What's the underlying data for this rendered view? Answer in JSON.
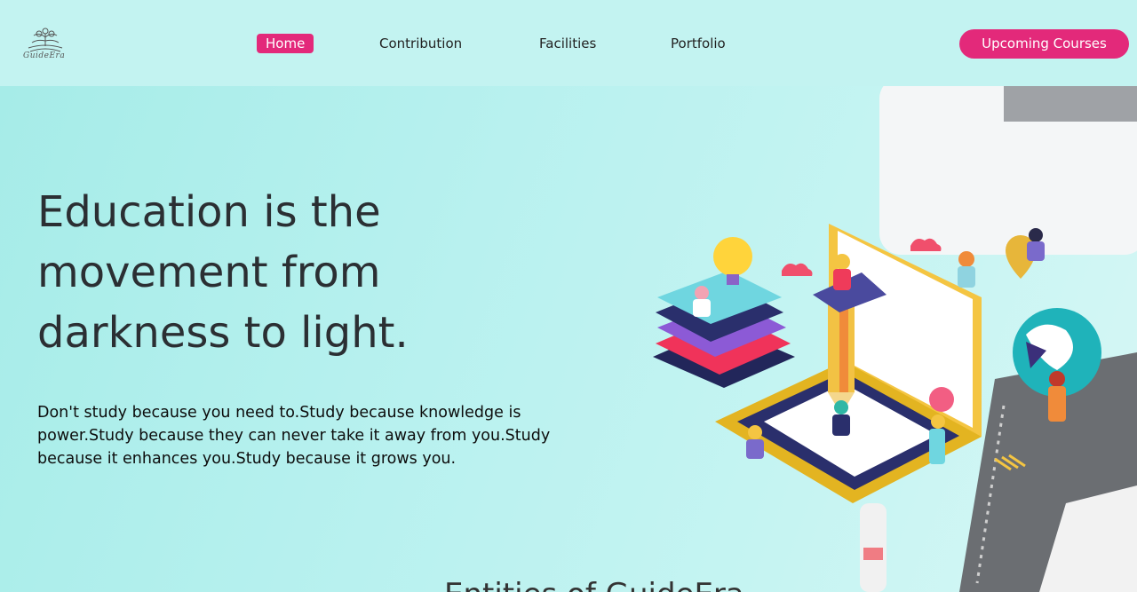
{
  "header": {
    "logo_text": "GuideEra",
    "nav": [
      {
        "label": "Home",
        "active": true
      },
      {
        "label": "Contribution",
        "active": false
      },
      {
        "label": "Facilities",
        "active": false
      },
      {
        "label": "Portfolio",
        "active": false
      }
    ],
    "cta_label": "Upcoming Courses"
  },
  "hero": {
    "headline_line1": "Education is the",
    "headline_line2": "movement from",
    "headline_line3": "darkness to light.",
    "body": "Don't study because you need to.Study because knowledge is power.Study because they can never take it away from you.Study because it enhances you.Study because it grows you."
  },
  "next_section": {
    "title_peek": "Entities of GuideEra"
  },
  "colors": {
    "accent": "#e3297a",
    "topbar_bg": "#c3f3f1",
    "hero_bg": "#bdf1f0"
  }
}
